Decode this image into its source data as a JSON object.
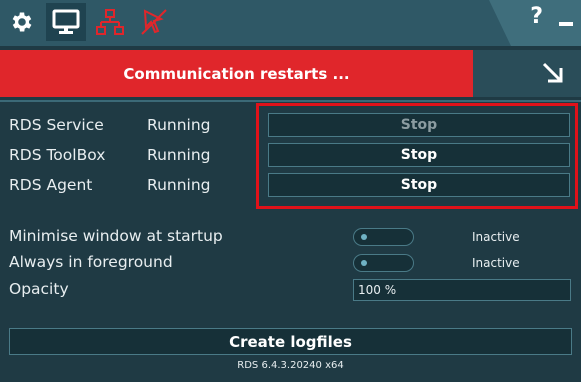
{
  "toolbar": {
    "icons": [
      "gear-icon",
      "monitor-icon",
      "network-icon",
      "cursor-disabled-icon"
    ],
    "help_label": "?",
    "accent": "#e0262b"
  },
  "banner": {
    "message": "Communication restarts ..."
  },
  "services": [
    {
      "name": "RDS Service",
      "status": "Running",
      "action": "Stop",
      "enabled": false
    },
    {
      "name": "RDS ToolBox",
      "status": "Running",
      "action": "Stop",
      "enabled": true
    },
    {
      "name": "RDS Agent",
      "status": "Running",
      "action": "Stop",
      "enabled": true
    }
  ],
  "settings": {
    "minimise": {
      "label": "Minimise window at startup",
      "state": "Inactive"
    },
    "foreground": {
      "label": "Always in foreground",
      "state": "Inactive"
    },
    "opacity": {
      "label": "Opacity",
      "value": "100 %"
    }
  },
  "actions": {
    "logfiles_label": "Create logfiles"
  },
  "footer": {
    "version": "RDS 6.4.3.20240 x64"
  }
}
